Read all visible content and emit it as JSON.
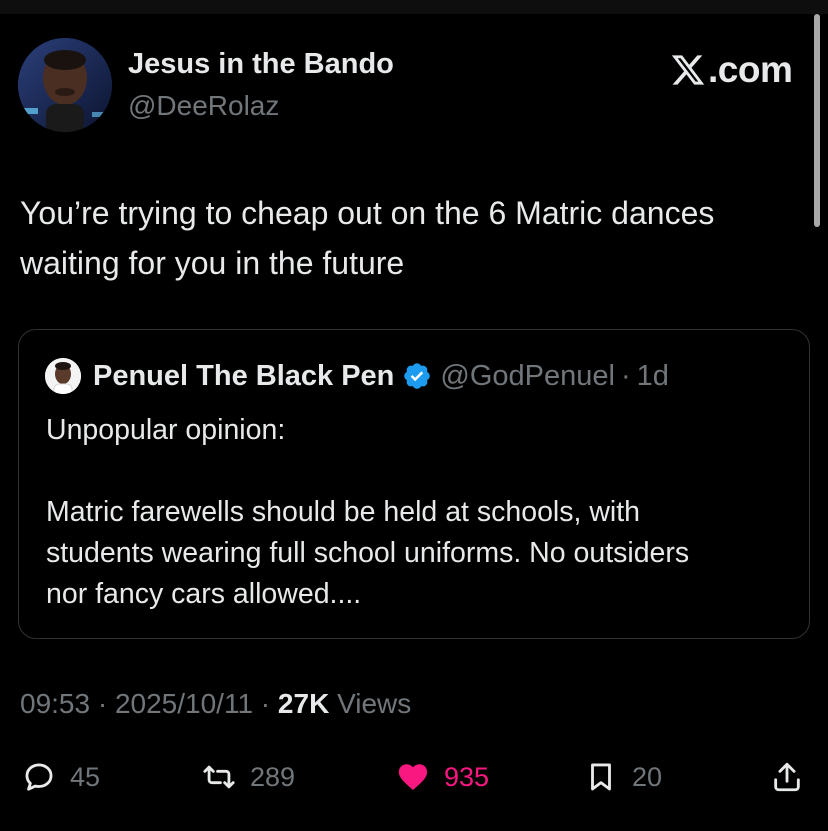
{
  "author": {
    "name": "Jesus in the Bando",
    "handle": "@DeeRolaz"
  },
  "brand": {
    "domain": ".com",
    "logo_icon": "x-logo-icon"
  },
  "tweet": {
    "text_line1": "You’re trying to cheap out on the 6 Matric dances",
    "text_line2": "waiting for you in the future"
  },
  "quote": {
    "name": "Penuel The Black Pen",
    "verified_icon": "verified-badge-icon",
    "handle": "@GodPenuel",
    "separator": "·",
    "time": "1d",
    "line1": "Unpopular opinion:",
    "line2": "Matric farewells should be held at schools, with",
    "line3": "students wearing full school uniforms. No outsiders",
    "line4": "nor fancy cars allowed...."
  },
  "meta": {
    "time": "09:53",
    "sep1": " · ",
    "date": "2025/10/11",
    "sep2": " · ",
    "views_count": "27K",
    "views_label": " Views"
  },
  "actions": {
    "replies": "45",
    "retweets": "289",
    "likes": "935",
    "bookmarks": "20"
  },
  "colors": {
    "background": "#000000",
    "text": "#e7e9ea",
    "muted": "#71767b",
    "like": "#f91880",
    "verified": "#1d9bf0",
    "border": "#2f3336"
  }
}
